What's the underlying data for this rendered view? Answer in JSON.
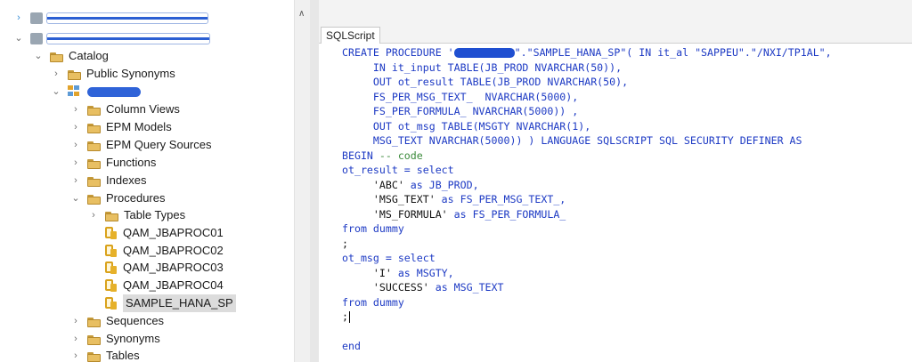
{
  "tree": {
    "catalog_label": "Catalog",
    "public_synonyms_label": "Public Synonyms",
    "folders": {
      "column_views": "Column Views",
      "epm_models": "EPM Models",
      "epm_query_sources": "EPM Query Sources",
      "functions": "Functions",
      "indexes": "Indexes",
      "procedures": "Procedures",
      "table_types": "Table Types",
      "sequences": "Sequences",
      "synonyms": "Synonyms",
      "tables": "Tables"
    },
    "procedures": [
      "QAM_JBAPROC01",
      "QAM_JBAPROC02",
      "QAM_JBAPROC03",
      "QAM_JBAPROC04",
      "SAMPLE_HANA_SP"
    ]
  },
  "editor": {
    "tab_label": "SQLScript",
    "code": {
      "l1_kw": "CREATE PROCEDURE ",
      "l1_q1": "'",
      "l1_rest": "\".\"SAMPLE_HANA_SP\"( IN it_al \"SAPPEU\".\"/NXI/TP1AL\",",
      "l2": "     IN it_input TABLE(JB_PROD NVARCHAR(50)),",
      "l3": "     OUT ot_result TABLE(JB_PROD NVARCHAR(50),",
      "l4": "     FS_PER_MSG_TEXT_  NVARCHAR(5000),",
      "l5": "     FS_PER_FORMULA_ NVARCHAR(5000)) ,",
      "l6": "     OUT ot_msg TABLE(MSGTY NVARCHAR(1),",
      "l7": "     MSG_TEXT NVARCHAR(5000)) ) LANGUAGE SQLSCRIPT SQL SECURITY DEFINER AS",
      "l8_kw": "BEGIN ",
      "l8_cm": "-- code",
      "l9": "ot_result = select",
      "l10_str": "     'ABC'",
      "l10_rest": " as JB_PROD,",
      "l11_str": "     'MSG_TEXT'",
      "l11_rest": " as FS_PER_MSG_TEXT_,",
      "l12_str": "     'MS_FORMULA'",
      "l12_rest": " as FS_PER_FORMULA_",
      "l13": "from dummy",
      "l14": ";",
      "l15": "ot_msg = select",
      "l16_str": "     'I'",
      "l16_rest": " as MSGTY,",
      "l17_str": "     'SUCCESS'",
      "l17_rest": " as MSG_TEXT",
      "l18": "from dummy",
      "l19": ";",
      "l20": "",
      "l21": "end"
    }
  }
}
